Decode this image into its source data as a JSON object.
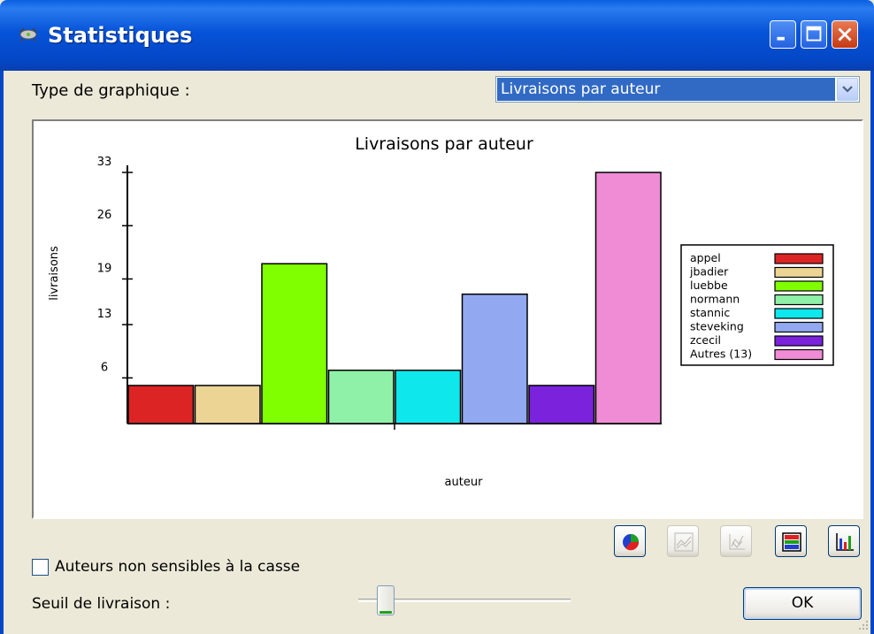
{
  "window": {
    "title": "Statistiques"
  },
  "form": {
    "type_label": "Type de graphique :",
    "type_value": "Livraisons par auteur",
    "checkbox_label": "Auteurs non sensibles à la casse",
    "checkbox_checked": false,
    "threshold_label": "Seuil de livraison :",
    "ok_label": "OK"
  },
  "toolbar": {
    "buttons": [
      "pie-chart",
      "line-chart",
      "scatter-chart",
      "stacked-bar-chart",
      "bar-chart"
    ],
    "disabled": [
      "line-chart",
      "scatter-chart"
    ]
  },
  "chart_data": {
    "type": "bar",
    "title": "Livraisons par auteur",
    "xlabel": "auteur",
    "ylabel": "livraisons",
    "ylim": [
      0,
      33
    ],
    "yticks": [
      "33",
      "26",
      "19",
      "13",
      "6"
    ],
    "ytick_values": [
      33,
      26,
      19,
      13,
      6
    ],
    "categories": [
      "appel",
      "jbadier",
      "luebbe",
      "normann",
      "stannic",
      "steveking",
      "zcecil",
      "Autres (13)"
    ],
    "values": [
      5,
      5,
      21,
      7,
      7,
      17,
      5,
      33
    ],
    "colors": [
      "#dc2424",
      "#ecd594",
      "#7fff00",
      "#8ff0a8",
      "#0ee8ec",
      "#92a8f0",
      "#7a22dc",
      "#f08cd6"
    ],
    "legend_position": "right"
  }
}
